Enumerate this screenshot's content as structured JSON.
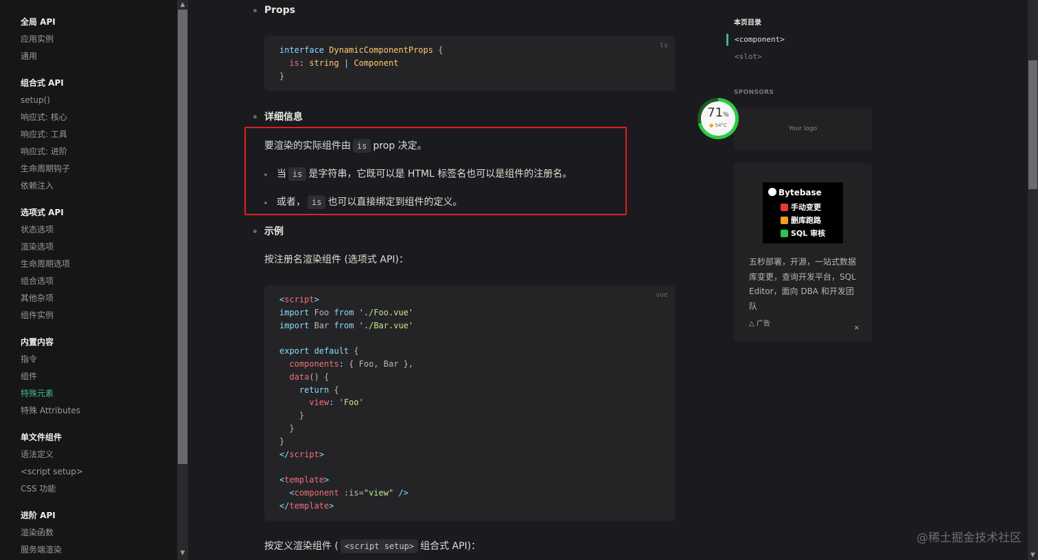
{
  "sidebar": {
    "groups": [
      {
        "title": "全局 API",
        "items": [
          "应用实例",
          "通用"
        ]
      },
      {
        "title": "组合式 API",
        "items": [
          "setup()",
          "响应式: 核心",
          "响应式: 工具",
          "响应式: 进阶",
          "生命周期钩子",
          "依赖注入"
        ]
      },
      {
        "title": "选项式 API",
        "items": [
          "状态选项",
          "渲染选项",
          "生命周期选项",
          "组合选项",
          "其他杂项",
          "组件实例"
        ]
      },
      {
        "title": "内置内容",
        "items": [
          "指令",
          "组件",
          "特殊元素",
          "特殊 Attributes"
        ]
      },
      {
        "title": "单文件组件",
        "items": [
          "语法定义",
          "<script setup>",
          "CSS 功能"
        ]
      },
      {
        "title": "进阶 API",
        "items": [
          "渲染函数",
          "服务端渲染"
        ]
      }
    ],
    "active_item": "特殊元素",
    "scroll_up": "▲",
    "scroll_down": "▼"
  },
  "main": {
    "props_heading": "Props",
    "props_code_lang": "ts",
    "details_heading": "详细信息",
    "details_intro_pre": "要渲染的实际组件由",
    "details_intro_code": "is",
    "details_intro_post": "prop 决定。",
    "bullet1_pre": "当",
    "bullet1_code": "is",
    "bullet1_post": "是字符串，它既可以是 HTML 标签名也可以是组件的注册名。",
    "bullet2_pre": "或者，",
    "bullet2_code": "is",
    "bullet2_post": "也可以直接绑定到组件的定义。",
    "example_heading": "示例",
    "example_intro": "按注册名渲染组件 (选项式 API)：",
    "example_code_lang": "vue",
    "example2_pre": "按定义渲染组件 (",
    "example2_code": "<script setup>",
    "example2_post": "组合式 API)："
  },
  "toc": {
    "title": "本页目录",
    "items": [
      "<component>",
      "<slot>"
    ]
  },
  "sponsors": {
    "label": "SPONSORS",
    "logo_text": "Your logo"
  },
  "ad": {
    "brand": "Bytebase",
    "lines": [
      "手动变更",
      "删库跑路",
      "SQL 审核"
    ],
    "line_marks": [
      "禁",
      "!",
      "✓"
    ],
    "text": "五秒部署，开源，一站式数据库变更，查询开发平台，SQL Editor，面向 DBA 和开发团队",
    "footer": "广告",
    "footer_icon": "△",
    "close": "×"
  },
  "gauge": {
    "value": "71",
    "unit": "%",
    "temp": "54°C",
    "temp_icon": "💧",
    "fill_fraction": 0.71
  },
  "watermark": "@稀土掘金技术社区",
  "colors": {
    "accent": "#42b883",
    "highlight_box": "#e02020"
  }
}
